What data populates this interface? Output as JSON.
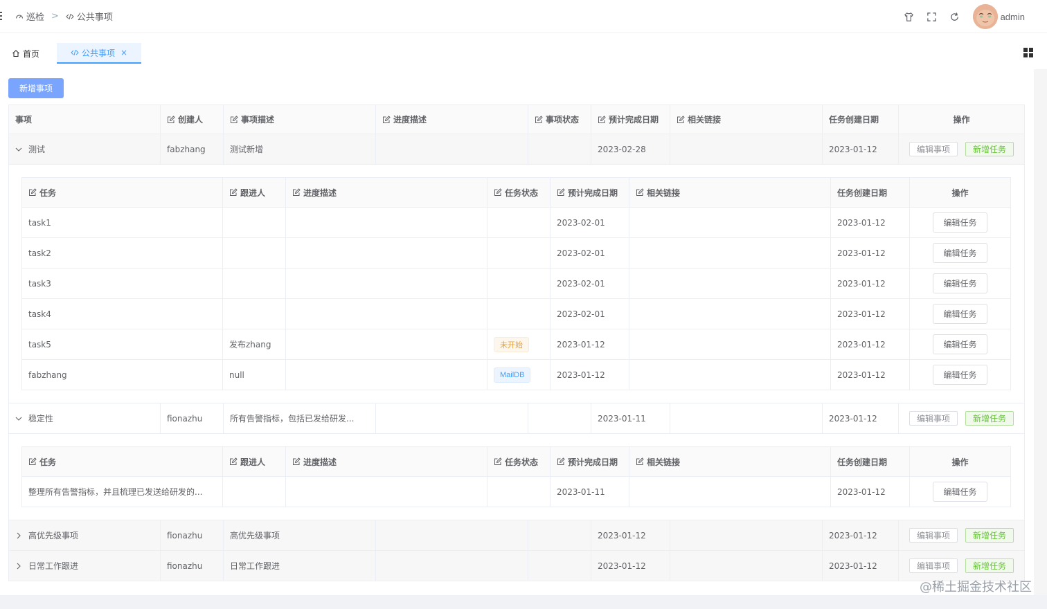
{
  "header": {
    "breadcrumb": [
      "巡检",
      "公共事项"
    ],
    "breadcrumb_sep": ">",
    "username": "admin",
    "icons": [
      "shirt-icon",
      "fullscreen-icon",
      "refresh-icon"
    ]
  },
  "tags": {
    "home": "首页",
    "active": "公共事项",
    "close": "×"
  },
  "add_button": "新增事项",
  "main_headers": [
    "事项",
    "创建人",
    "事项描述",
    "进度描述",
    "事项状态",
    "预计完成日期",
    "相关链接",
    "任务创建日期",
    "操作"
  ],
  "sub_headers": [
    "任务",
    "跟进人",
    "进度描述",
    "任务状态",
    "预计完成日期",
    "相关链接",
    "任务创建日期",
    "操作"
  ],
  "buttons": {
    "edit_item": "编辑事项",
    "new_task": "新增任务",
    "edit_task": "编辑任务"
  },
  "items": [
    {
      "name": "测试",
      "creator": "fabzhang",
      "desc": "测试新增",
      "progress": "",
      "status": "",
      "due": "2023-02-28",
      "link": "",
      "created": "2023-01-12",
      "tasks": [
        {
          "task": "task1",
          "owner": "",
          "progress": "",
          "status": "",
          "due": "2023-02-01",
          "link": "",
          "created": "2023-01-12"
        },
        {
          "task": "task2",
          "owner": "",
          "progress": "",
          "status": "",
          "due": "2023-02-01",
          "link": "",
          "created": "2023-01-12"
        },
        {
          "task": "task3",
          "owner": "",
          "progress": "",
          "status": "",
          "due": "2023-02-01",
          "link": "",
          "created": "2023-01-12"
        },
        {
          "task": "task4",
          "owner": "",
          "progress": "",
          "status": "",
          "due": "2023-02-01",
          "link": "",
          "created": "2023-01-12"
        },
        {
          "task": "task5",
          "owner": "发布zhang",
          "progress": "",
          "status": "未开始",
          "due": "2023-01-12",
          "link": "",
          "created": "2023-01-12"
        },
        {
          "task": "fabzhang",
          "owner": "null",
          "progress": "",
          "status": "MailDB",
          "due": "2023-01-12",
          "link": "",
          "created": "2023-01-12"
        }
      ]
    },
    {
      "name": "稳定性",
      "creator": "fionazhu",
      "desc": "所有告警指标，包括已发给研发...",
      "progress": "",
      "status": "",
      "due": "2023-01-11",
      "link": "",
      "created": "2023-01-12",
      "tasks": [
        {
          "task": "整理所有告警指标，并且梳理已发送给研发的...",
          "owner": "",
          "progress": "",
          "status": "",
          "due": "2023-01-11",
          "link": "",
          "created": "2023-01-12"
        }
      ]
    },
    {
      "name": "高优先级事项",
      "creator": "fionazhu",
      "desc": "高优先级事项",
      "progress": "",
      "status": "",
      "due": "2023-01-12",
      "link": "",
      "created": "2023-01-12"
    },
    {
      "name": "日常工作跟进",
      "creator": "fionazhu",
      "desc": "日常工作跟进",
      "progress": "",
      "status": "",
      "due": "2023-01-12",
      "link": "",
      "created": "2023-01-12"
    }
  ],
  "watermark": "@稀土掘金技术社区"
}
